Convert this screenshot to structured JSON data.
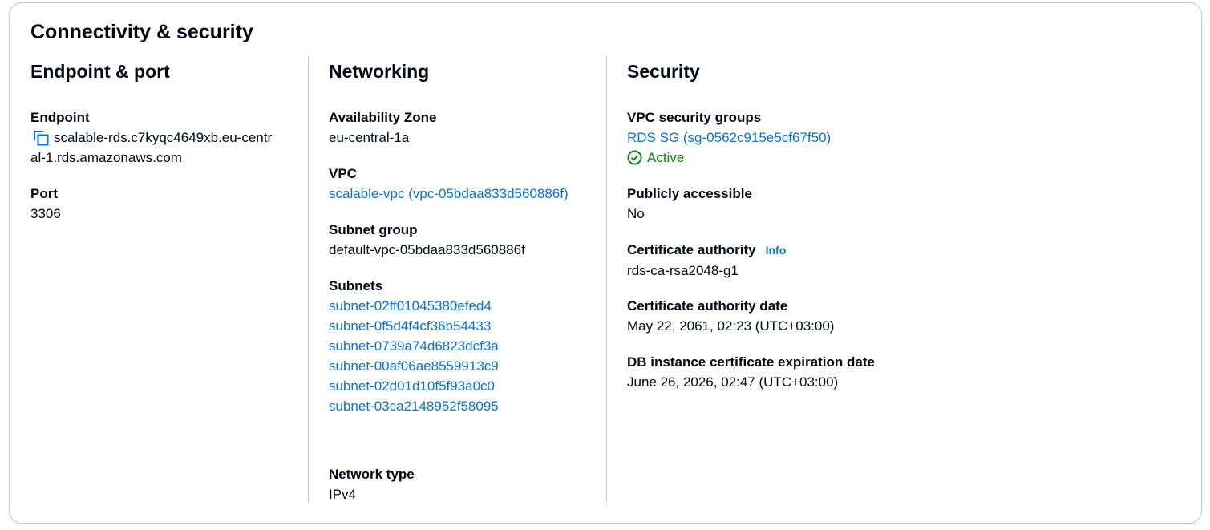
{
  "panel": {
    "title": "Connectivity & security"
  },
  "endpoint_port": {
    "title": "Endpoint & port",
    "endpoint_label": "Endpoint",
    "endpoint_line1": "scalable-rds.c7kyqc4649xb.eu-centr",
    "endpoint_line2": "al-1.rds.amazonaws.com",
    "port_label": "Port",
    "port_value": "3306",
    "copy_icon": "copy-icon"
  },
  "networking": {
    "title": "Networking",
    "az_label": "Availability Zone",
    "az_value": "eu-central-1a",
    "vpc_label": "VPC",
    "vpc_value": "scalable-vpc (vpc-05bdaa833d560886f)",
    "subnet_group_label": "Subnet group",
    "subnet_group_value": "default-vpc-05bdaa833d560886f",
    "subnets_label": "Subnets",
    "subnets": [
      "subnet-02ff01045380efed4",
      "subnet-0f5d4f4cf36b54433",
      "subnet-0739a74d6823dcf3a",
      "subnet-00af06ae8559913c9",
      "subnet-02d01d10f5f93a0c0",
      "subnet-03ca2148952f58095"
    ],
    "network_type_label": "Network type",
    "network_type_value": "IPv4"
  },
  "security": {
    "title": "Security",
    "sg_label": "VPC security groups",
    "sg_value": "RDS SG (sg-0562c915e5cf67f50)",
    "sg_status": "Active",
    "status_icon": "check-circle-icon",
    "public_label": "Publicly accessible",
    "public_value": "No",
    "ca_label": "Certificate authority",
    "ca_info": "Info",
    "ca_value": "rds-ca-rsa2048-g1",
    "ca_date_label": "Certificate authority date",
    "ca_date_value": "May 22, 2061, 02:23 (UTC+03:00)",
    "cert_exp_label": "DB instance certificate expiration date",
    "cert_exp_value": "June 26, 2026, 02:47 (UTC+03:00)"
  },
  "colors": {
    "link": "#0972d3",
    "success": "#037f0c",
    "text": "#000716",
    "divider": "#c6c6cd"
  }
}
